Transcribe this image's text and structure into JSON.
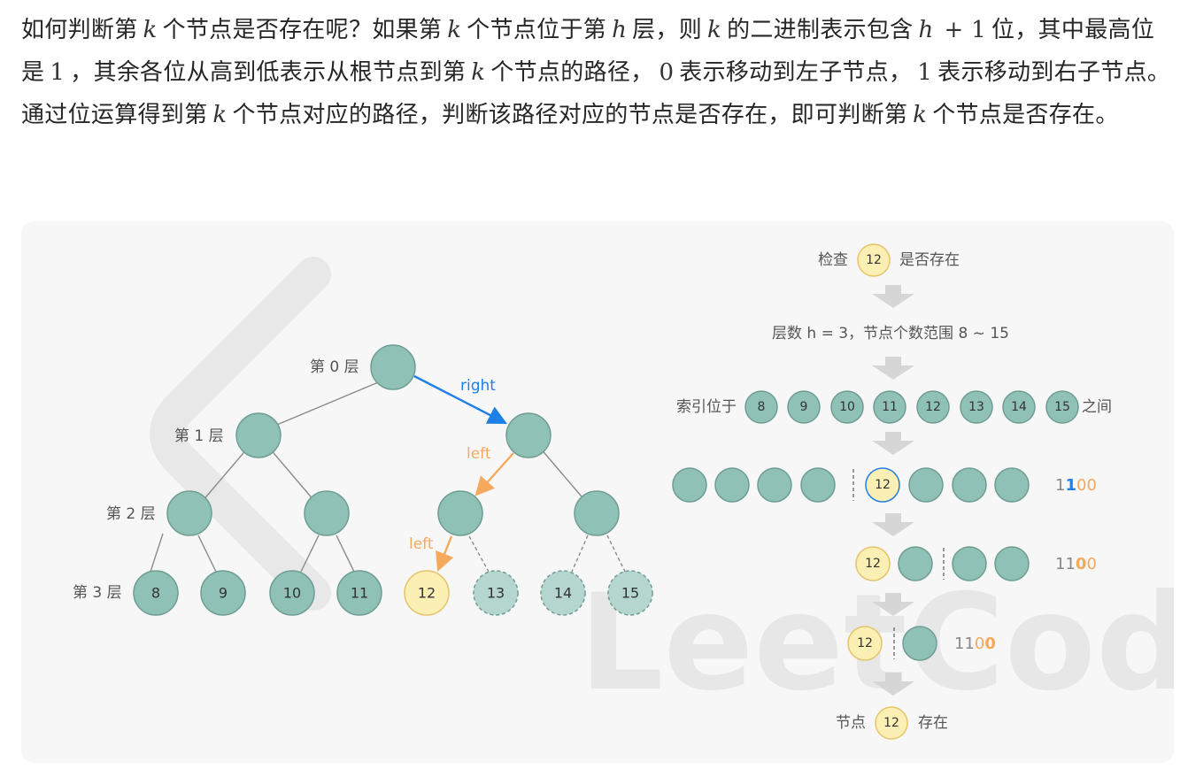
{
  "paragraph": {
    "segments": [
      {
        "t": "text",
        "v": "如何判断第"
      },
      {
        "t": "var",
        "v": "k"
      },
      {
        "t": "text",
        "v": "个节点是否存在呢？如果第"
      },
      {
        "t": "var",
        "v": "k"
      },
      {
        "t": "text",
        "v": "个节点位于第"
      },
      {
        "t": "var",
        "v": "h"
      },
      {
        "t": "text",
        "v": "层，则"
      },
      {
        "t": "var",
        "v": "k"
      },
      {
        "t": "text",
        "v": "的二进制表示包含"
      },
      {
        "t": "var",
        "v": "h"
      },
      {
        "t": "num",
        "v": "+ 1"
      },
      {
        "t": "text",
        "v": "位，其中最高位是"
      },
      {
        "t": "num",
        "v": "1"
      },
      {
        "t": "text",
        "v": "，其余各位从高到低表示从根节点到第"
      },
      {
        "t": "var",
        "v": "k"
      },
      {
        "t": "text",
        "v": "个节点的路径，"
      },
      {
        "t": "num",
        "v": "0"
      },
      {
        "t": "text",
        "v": "表示移动到左子节点，"
      },
      {
        "t": "num",
        "v": "1"
      },
      {
        "t": "text",
        "v": "表示移动到右子节点。通过位运算得到第"
      },
      {
        "t": "var",
        "v": "k"
      },
      {
        "t": "text",
        "v": "个节点对应的路径，判断该路径对应的节点是否存在，即可判断第"
      },
      {
        "t": "var",
        "v": "k"
      },
      {
        "t": "text",
        "v": "个节点是否存在。"
      }
    ]
  },
  "colors": {
    "node": "#8fc1b7",
    "node_stroke": "#6f9d94",
    "target": "#fcefb4",
    "target_stroke": "#e5c46b",
    "dashed_node": "#b4d6cf",
    "edge": "#8a8a8a",
    "right_arrow": "#1e7fe6",
    "left_arrow": "#f5a95c",
    "flow_arrow": "#d6d6d6",
    "bit_blue": "#1e7fe6",
    "bit_orange": "#f5a95c",
    "bit_gray": "#888888"
  },
  "tree": {
    "level_labels": [
      "第 0 层",
      "第 1 层",
      "第 2 层",
      "第 3 层"
    ],
    "leaves": [
      "8",
      "9",
      "10",
      "11",
      "12",
      "13",
      "14",
      "15"
    ],
    "arrow_labels": {
      "right": "right",
      "left1": "left",
      "left2": "left"
    }
  },
  "flow": {
    "step1": {
      "pre": "检查",
      "node": "12",
      "post": "是否存在"
    },
    "step2": "层数 h = 3，节点个数范围 8 ~ 15",
    "step3": {
      "pre": "索引位于",
      "nodes": [
        "8",
        "9",
        "10",
        "11",
        "12",
        "13",
        "14",
        "15"
      ],
      "post": "之间"
    },
    "row1": {
      "node": "12",
      "bits": [
        "1",
        "1",
        "0",
        "0"
      ]
    },
    "row2": {
      "node": "12",
      "bits": [
        "1",
        "1",
        "0",
        "0"
      ]
    },
    "row3": {
      "node": "12",
      "bits": [
        "1",
        "1",
        "0",
        "0"
      ]
    },
    "result": {
      "pre": "节点",
      "node": "12",
      "post": "存在"
    }
  },
  "watermark": "LeetCode"
}
